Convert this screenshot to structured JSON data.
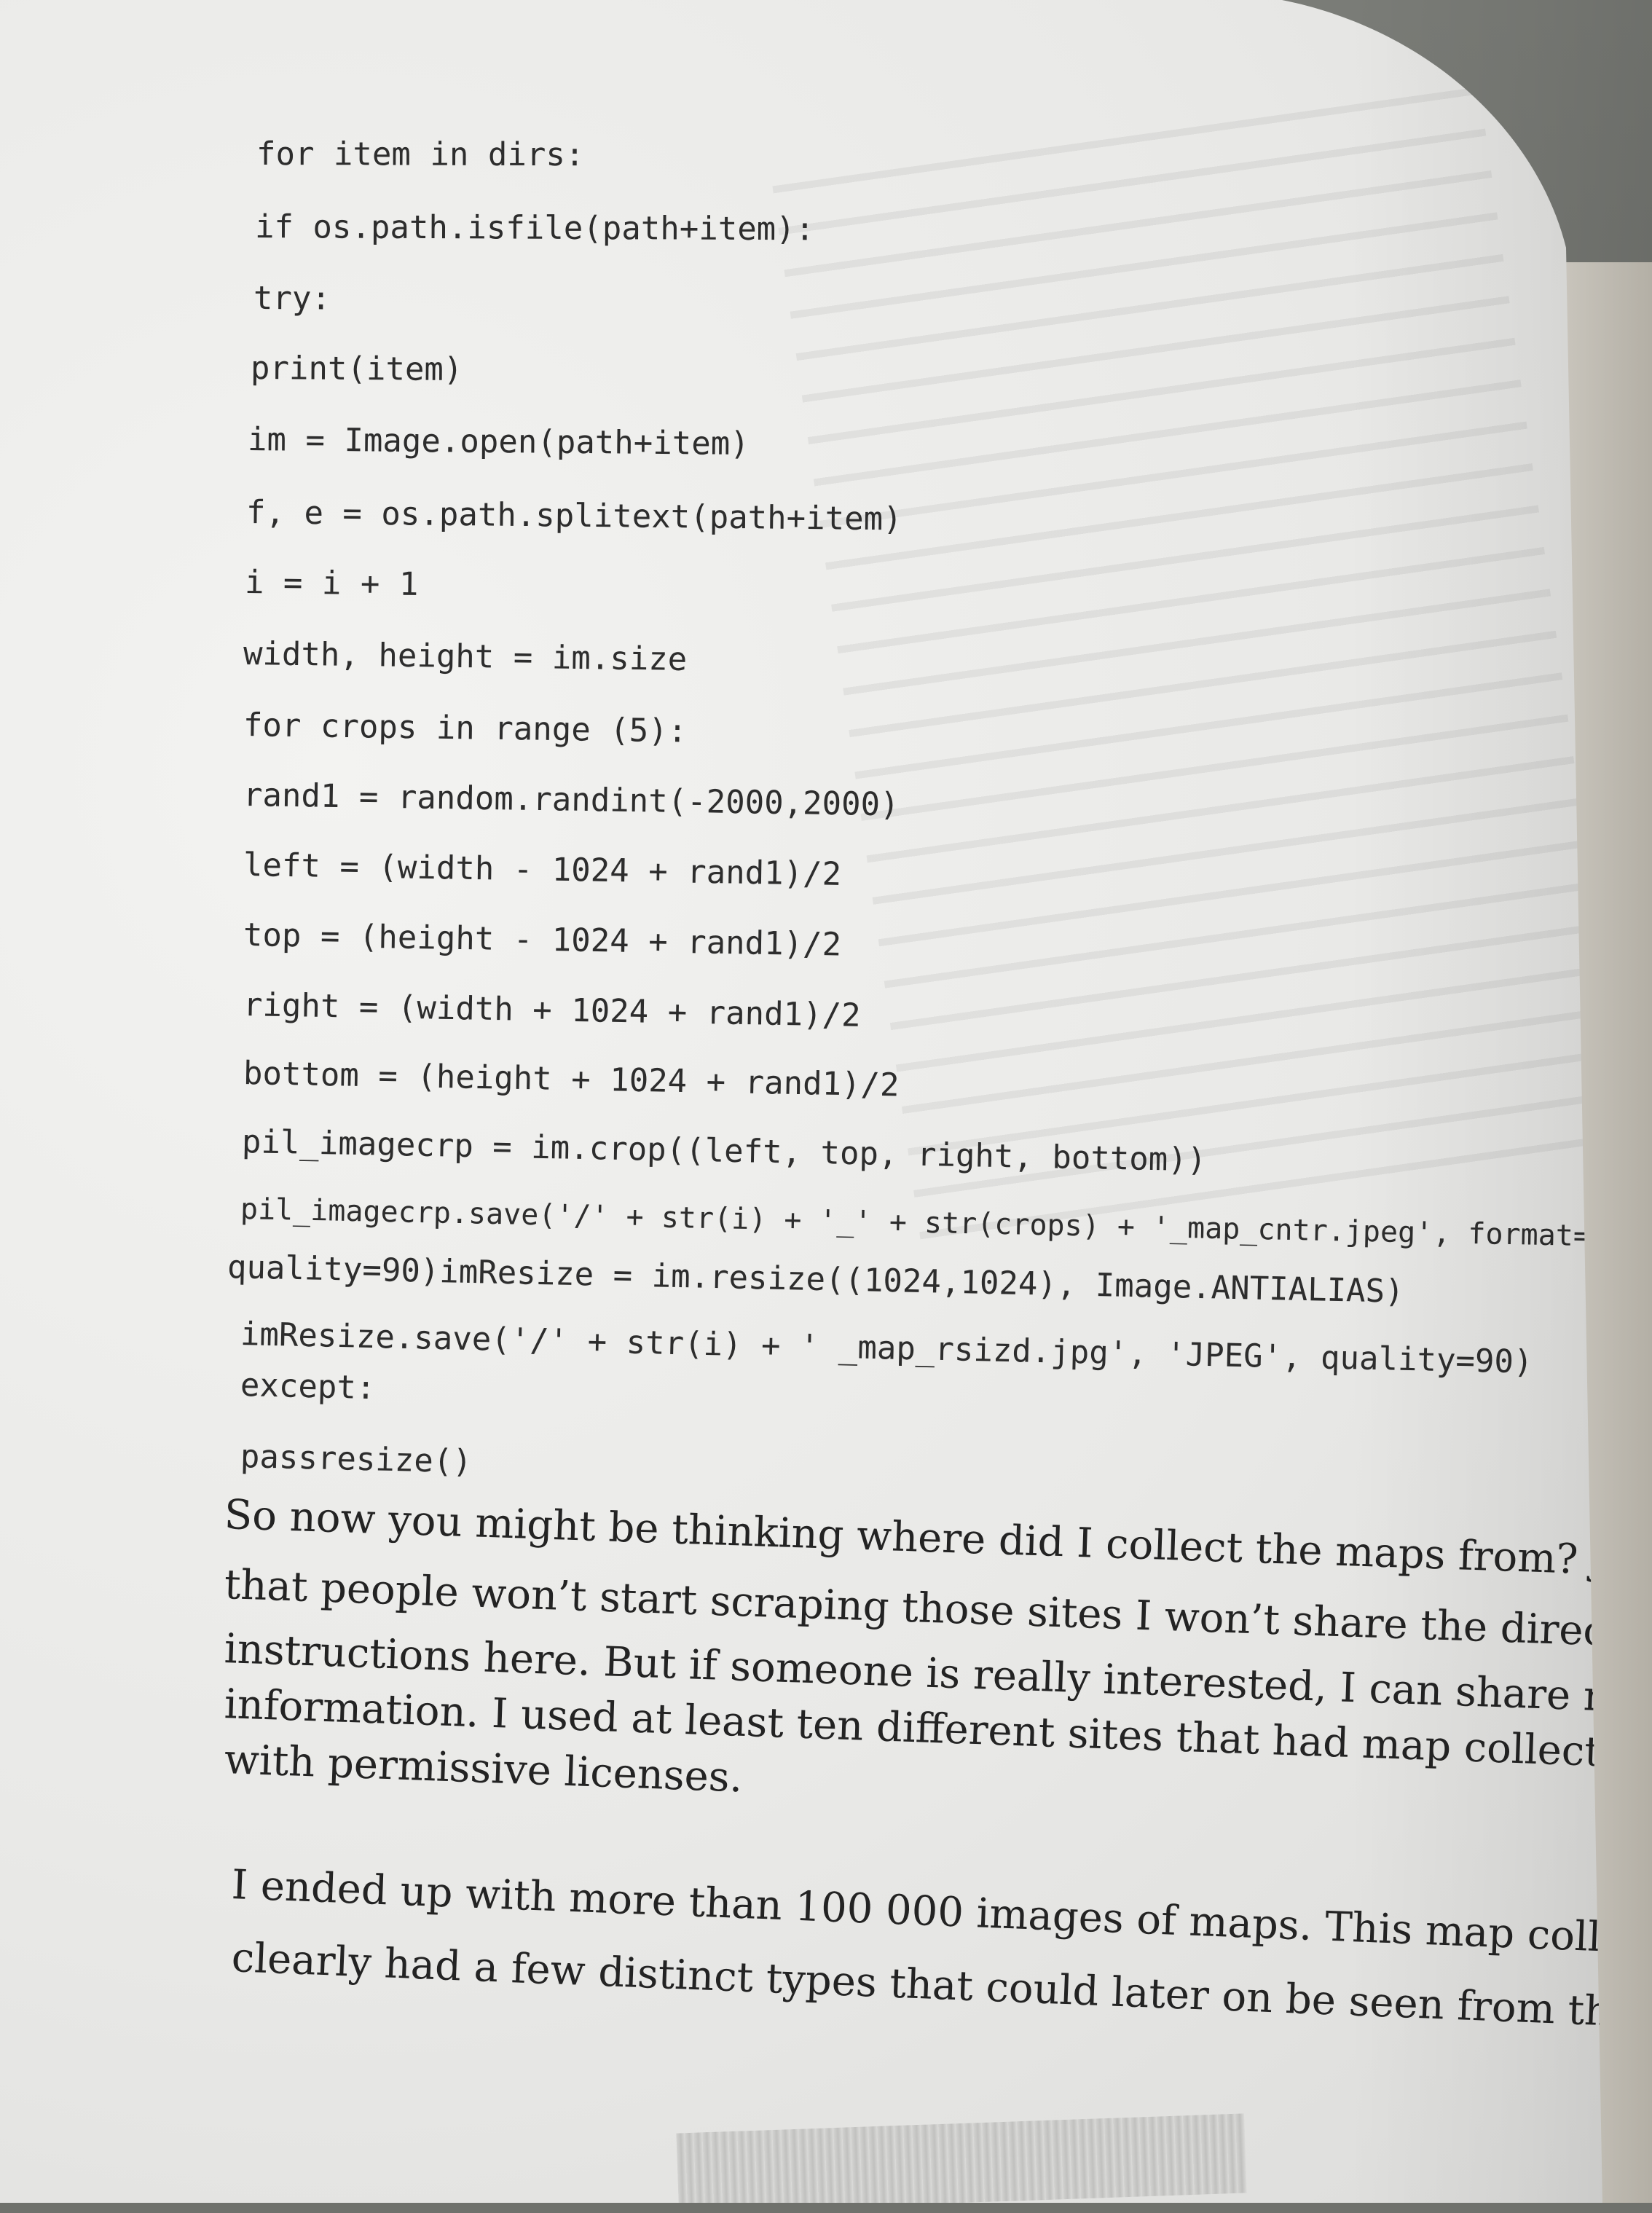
{
  "code": {
    "lines": [
      "for item in dirs:",
      "if os.path.isfile(path+item):",
      "try:",
      "print(item)",
      "im = Image.open(path+item)",
      "f, e = os.path.splitext(path+item)",
      "i = i + 1",
      "width, height = im.size",
      "for crops in range (5):",
      "rand1 = random.randint(-2000,2000)",
      "left = (width - 1024 + rand1)/2",
      "top = (height - 1024 + rand1)/2",
      "right = (width + 1024 + rand1)/2",
      "bottom = (height + 1024 + rand1)/2",
      "pil_imagecrp = im.crop((left, top, right, bottom))",
      "pil_imagecrp.save('/' + str(i) + '_' + str(crops) + '_map_cntr.jpeg', format='JPEG',",
      "quality=90)imResize = im.resize((1024,1024), Image.ANTIALIAS)",
      "imResize.save('/' + str(i) + ' _map_rsizd.jpg', 'JPEG', quality=90)",
      "except:",
      "passresize()"
    ]
  },
  "prose": {
    "paragraph1": [
      "So now you might be thinking where did I collect the maps from? Just so",
      "that people won’t start scraping those sites I won’t share the direct links or",
      "instructions here. But if someone is really interested, I can share more",
      "information. I used at least ten different sites that had map collections",
      "with permissive licenses."
    ],
    "paragraph2": [
      "I ended up with more than 100 000 images of maps. This map collection",
      "clearly had a few distinct types that could later on be seen from the results"
    ]
  }
}
